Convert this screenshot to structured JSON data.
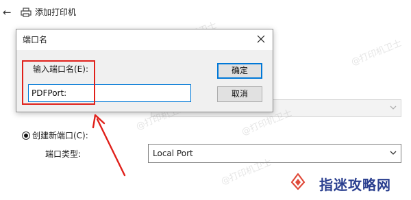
{
  "wizard": {
    "back_icon": "←",
    "title": "添加打印机",
    "radio_create_new_label": "创建新端口(C):",
    "port_type_label": "端口类型:",
    "port_type_value": "Local Port"
  },
  "dialog": {
    "title": "端口名",
    "close_glyph": "✕",
    "prompt_label": "输入端口名(E):",
    "port_name_value": "PDFPort:",
    "ok_label": "确定",
    "cancel_label": "取消"
  },
  "watermark": {
    "text": "@打印机卫士",
    "brand": "指迷攻略网"
  },
  "colors": {
    "accent": "#0078d7",
    "annotation_red": "#e0201a",
    "brand_blue": "#2a3f8f",
    "brand_red": "#e04a3a"
  }
}
